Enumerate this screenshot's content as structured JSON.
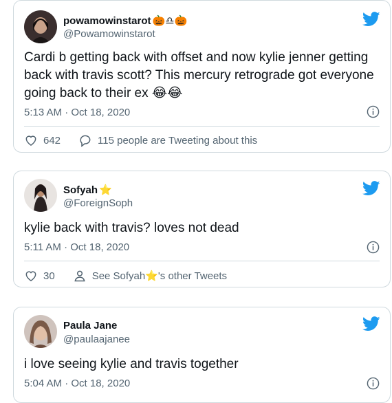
{
  "tweets": [
    {
      "name": "powamowinstarot",
      "name_suffix": "🎃♎🎃",
      "handle": "@Powamowinstarot",
      "text": "Cardi b getting back with offset and now kylie jenner getting back with travis scott? This mercury retrograde got everyone going back to their ex 😂😂",
      "timestamp": "5:13 AM · Oct 18, 2020",
      "likes": "642",
      "second_action": "115 people are Tweeting about this"
    },
    {
      "name": "Sofyah",
      "name_suffix": "⭐",
      "handle": "@ForeignSoph",
      "text": "kylie back with travis? loves not dead",
      "timestamp": "5:11 AM · Oct 18, 2020",
      "likes": "30",
      "second_action": "See Sofyah⭐'s other Tweets"
    },
    {
      "name": "Paula Jane",
      "name_suffix": "",
      "handle": "@paulaajanee",
      "text": "i love seeing kylie and travis together",
      "timestamp": "5:04 AM · Oct 18, 2020"
    }
  ],
  "colors": {
    "twitter_blue": "#1d9bf0",
    "secondary_text": "#536471",
    "border": "#cfd9de"
  }
}
